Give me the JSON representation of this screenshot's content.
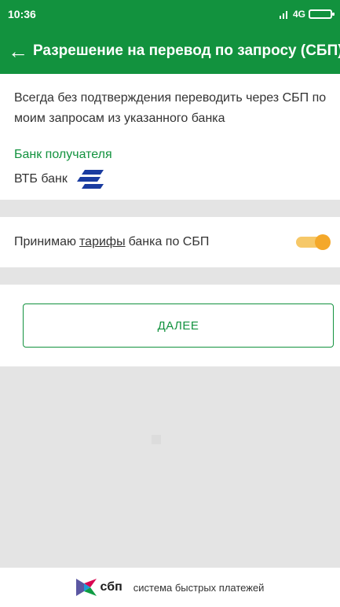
{
  "status_bar": {
    "time": "10:36",
    "network": "4G"
  },
  "app_bar": {
    "title": "Разрешение на перевод по запросу (СБП)",
    "back_icon": "arrow-left-icon"
  },
  "info": {
    "description": "Всегда без подтверждения переводить через СБП по моим запросам из указанного банка",
    "bank_label": "Банк получателя",
    "bank_name": "ВТБ банк",
    "bank_logo_icon": "vtb-logo-icon"
  },
  "tariffs": {
    "text_before": "Принимаю",
    "link_text": "тарифы",
    "text_after": "банка по СБП",
    "toggle_on": true
  },
  "actions": {
    "next_label": "ДАЛЕЕ"
  },
  "footer": {
    "logo_mark": "сбп",
    "caption": "система быстрых платежей"
  },
  "colors": {
    "primary": "#12923e",
    "toggle_knob": "#f4a82a",
    "toggle_track": "#f6c868",
    "background": "#e4e4e4"
  }
}
